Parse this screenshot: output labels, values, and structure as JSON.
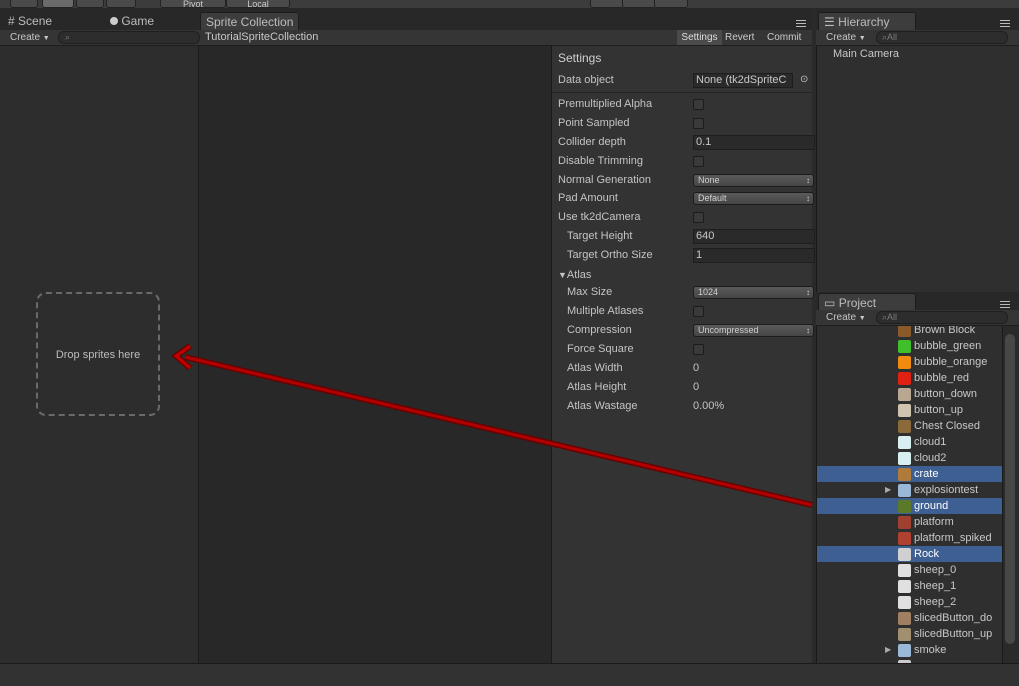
{
  "toolbar": {
    "pivot": "Pivot",
    "space": "Local"
  },
  "tabs": {
    "scene": "Scene",
    "game": "Game",
    "sprite_collection": "Sprite Collection",
    "hierarchy": "Hierarchy",
    "project": "Project"
  },
  "scene_bar": {
    "create": "Create",
    "collection_name": "TutorialSpriteCollection",
    "settings_btn": "Settings",
    "revert_btn": "Revert",
    "commit_btn": "Commit"
  },
  "dropzone": {
    "label": "Drop sprites here"
  },
  "settings": {
    "title": "Settings",
    "data_object_label": "Data object",
    "data_object_value": "None (tk2dSpriteC",
    "premultiplied_alpha": "Premultiplied Alpha",
    "point_sampled": "Point Sampled",
    "collider_depth": "Collider depth",
    "collider_depth_value": "0.1",
    "disable_trimming": "Disable Trimming",
    "normal_generation": "Normal Generation",
    "normal_generation_value": "None",
    "pad_amount": "Pad Amount",
    "pad_amount_value": "Default",
    "use_tk2d_camera": "Use tk2dCamera",
    "target_height": "Target Height",
    "target_height_value": "640",
    "target_ortho_size": "Target Ortho Size",
    "target_ortho_size_value": "1",
    "atlas": "Atlas",
    "max_size": "Max Size",
    "max_size_value": "1024",
    "multiple_atlases": "Multiple Atlases",
    "compression": "Compression",
    "compression_value": "Uncompressed",
    "force_square": "Force Square",
    "atlas_width": "Atlas Width",
    "atlas_width_value": "0",
    "atlas_height": "Atlas Height",
    "atlas_height_value": "0",
    "atlas_wastage": "Atlas Wastage",
    "atlas_wastage_value": "0.00%"
  },
  "hierarchy": {
    "create": "Create",
    "search_placeholder": "All",
    "items": [
      "Main Camera"
    ]
  },
  "project": {
    "create": "Create",
    "search_placeholder": "All",
    "items": [
      {
        "label": "Brown Block",
        "color": "#8a5a2b"
      },
      {
        "label": "bubble_green",
        "color": "#3fbf2a"
      },
      {
        "label": "bubble_orange",
        "color": "#f08a10"
      },
      {
        "label": "bubble_red",
        "color": "#e02010"
      },
      {
        "label": "button_down",
        "color": "#b8a892"
      },
      {
        "label": "button_up",
        "color": "#d0c4b0"
      },
      {
        "label": "Chest Closed",
        "color": "#8a6a3a"
      },
      {
        "label": "cloud1",
        "color": "#d8eef0"
      },
      {
        "label": "cloud2",
        "color": "#d8eef0"
      },
      {
        "label": "crate",
        "color": "#b07a3a",
        "selected": true
      },
      {
        "label": "explosiontest",
        "color": "#9ab8d8",
        "folder": true
      },
      {
        "label": "ground",
        "color": "#5a7a2a",
        "selected": true
      },
      {
        "label": "platform",
        "color": "#a04030"
      },
      {
        "label": "platform_spiked",
        "color": "#b04030"
      },
      {
        "label": "Rock",
        "color": "#d0d0d0",
        "selected": true
      },
      {
        "label": "sheep_0",
        "color": "#e0e0e0"
      },
      {
        "label": "sheep_1",
        "color": "#e0e0e0"
      },
      {
        "label": "sheep_2",
        "color": "#e0e0e0"
      },
      {
        "label": "slicedButton_do",
        "color": "#a08060"
      },
      {
        "label": "slicedButton_up",
        "color": "#a09070"
      },
      {
        "label": "smoke",
        "color": "#9ab8d8",
        "folder": true
      },
      {
        "label": "source",
        "color": "#cccccc"
      }
    ]
  },
  "colors": {
    "selection": "#3e5f91",
    "arrow": "#b00000"
  }
}
